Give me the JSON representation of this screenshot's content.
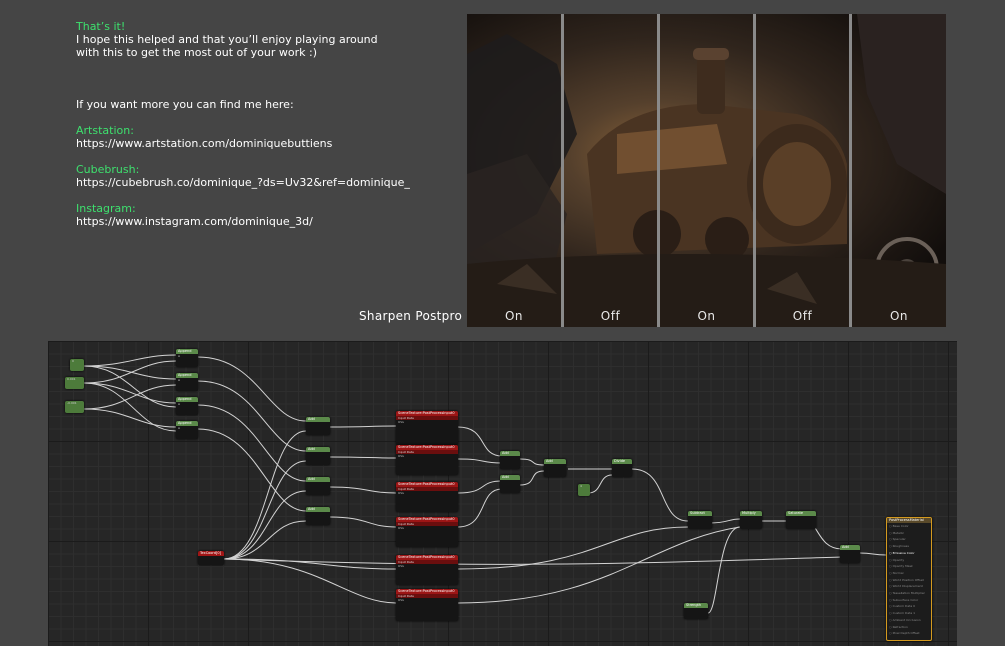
{
  "intro": {
    "heading": "That’s it!",
    "line1": "I hope this helped and that you’ll enjoy playing around",
    "line2": "with this to get the most out of your work :)",
    "more": "If you want more you can find me here:"
  },
  "links": [
    {
      "label": "Artstation:",
      "url": "https://www.artstation.com/dominiquebuttiens"
    },
    {
      "label": "Cubebrush:",
      "url": "https://cubebrush.co/dominique_?ds=Uv32&ref=dominique_"
    },
    {
      "label": "Instagram:",
      "url": "https://www.instagram.com/dominique_3d/"
    }
  ],
  "comparison": {
    "label": "Sharpen Postpro",
    "panels": [
      "On",
      "Off",
      "On",
      "Off",
      "On"
    ]
  },
  "graph": {
    "constants": [
      "0",
      "0.001",
      "-0.001"
    ],
    "append_label": "Append",
    "add_label": "Add",
    "scene_texture_title": "SceneTexture:PostProcessInput0",
    "scene_texture_sub": "Input Data",
    "pins": {
      "uvs": "UVs",
      "color": "Color",
      "size": "Size",
      "invsize": "InvSize"
    },
    "texcoord_label": "TexCoord[0]",
    "divide_label": "Divide",
    "divide_const": "4",
    "subtract_label": "Subtract",
    "multiply_label": "Multiply",
    "saturate_label": "Saturate",
    "strength_label": "Strength",
    "output_title": "PostProcessMaterial",
    "output_pins": [
      "Base Color",
      "Metallic",
      "Specular",
      "Roughness",
      "Emissive Color",
      "Opacity",
      "Opacity Mask",
      "Normal",
      "World Position Offset",
      "World Displacement",
      "Tessellation Multiplier",
      "Subsurface Color",
      "Custom Data 0",
      "Custom Data 1",
      "Ambient Occlusion",
      "Refraction",
      "Pixel Depth Offset"
    ]
  },
  "colors": {
    "background": "#454545",
    "link_label": "#3ee06e",
    "graph_bg": "#262626",
    "node_green": "#5b8a4a",
    "node_red": "#9d1515",
    "output_border": "#d49a1f"
  }
}
